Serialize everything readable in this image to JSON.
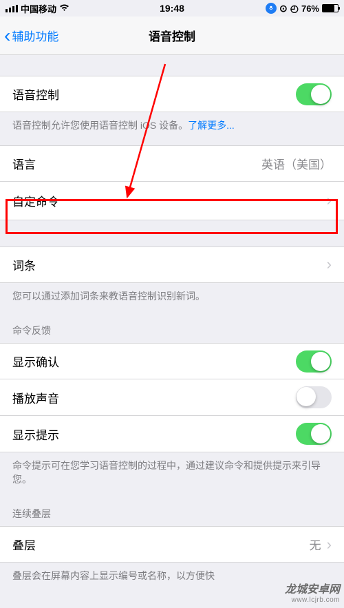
{
  "statusBar": {
    "carrier": "中国移动",
    "time": "19:48",
    "batteryPercent": "76%"
  },
  "nav": {
    "backLabel": "辅助功能",
    "title": "语音控制"
  },
  "voiceControl": {
    "label": "语音控制",
    "footer": "语音控制允许您使用语音控制 iOS 设备。",
    "learnMore": "了解更多..."
  },
  "language": {
    "label": "语言",
    "value": "英语（美国）"
  },
  "customCommands": {
    "label": "自定命令"
  },
  "vocabulary": {
    "label": "词条",
    "footer": "您可以通过添加词条来教语音控制识别新词。"
  },
  "feedback": {
    "header": "命令反馈",
    "showConfirm": "显示确认",
    "playSound": "播放声音",
    "showHints": "显示提示",
    "footer": "命令提示可在您学习语音控制的过程中，通过建议命令和提供提示来引导您。"
  },
  "overlay": {
    "header": "连续叠层",
    "label": "叠层",
    "value": "无",
    "footer": "叠层会在屏幕内容上显示编号或名称，以方便快"
  },
  "watermark": {
    "zh": "龙城安卓网",
    "en": "www.lcjrb.com"
  }
}
